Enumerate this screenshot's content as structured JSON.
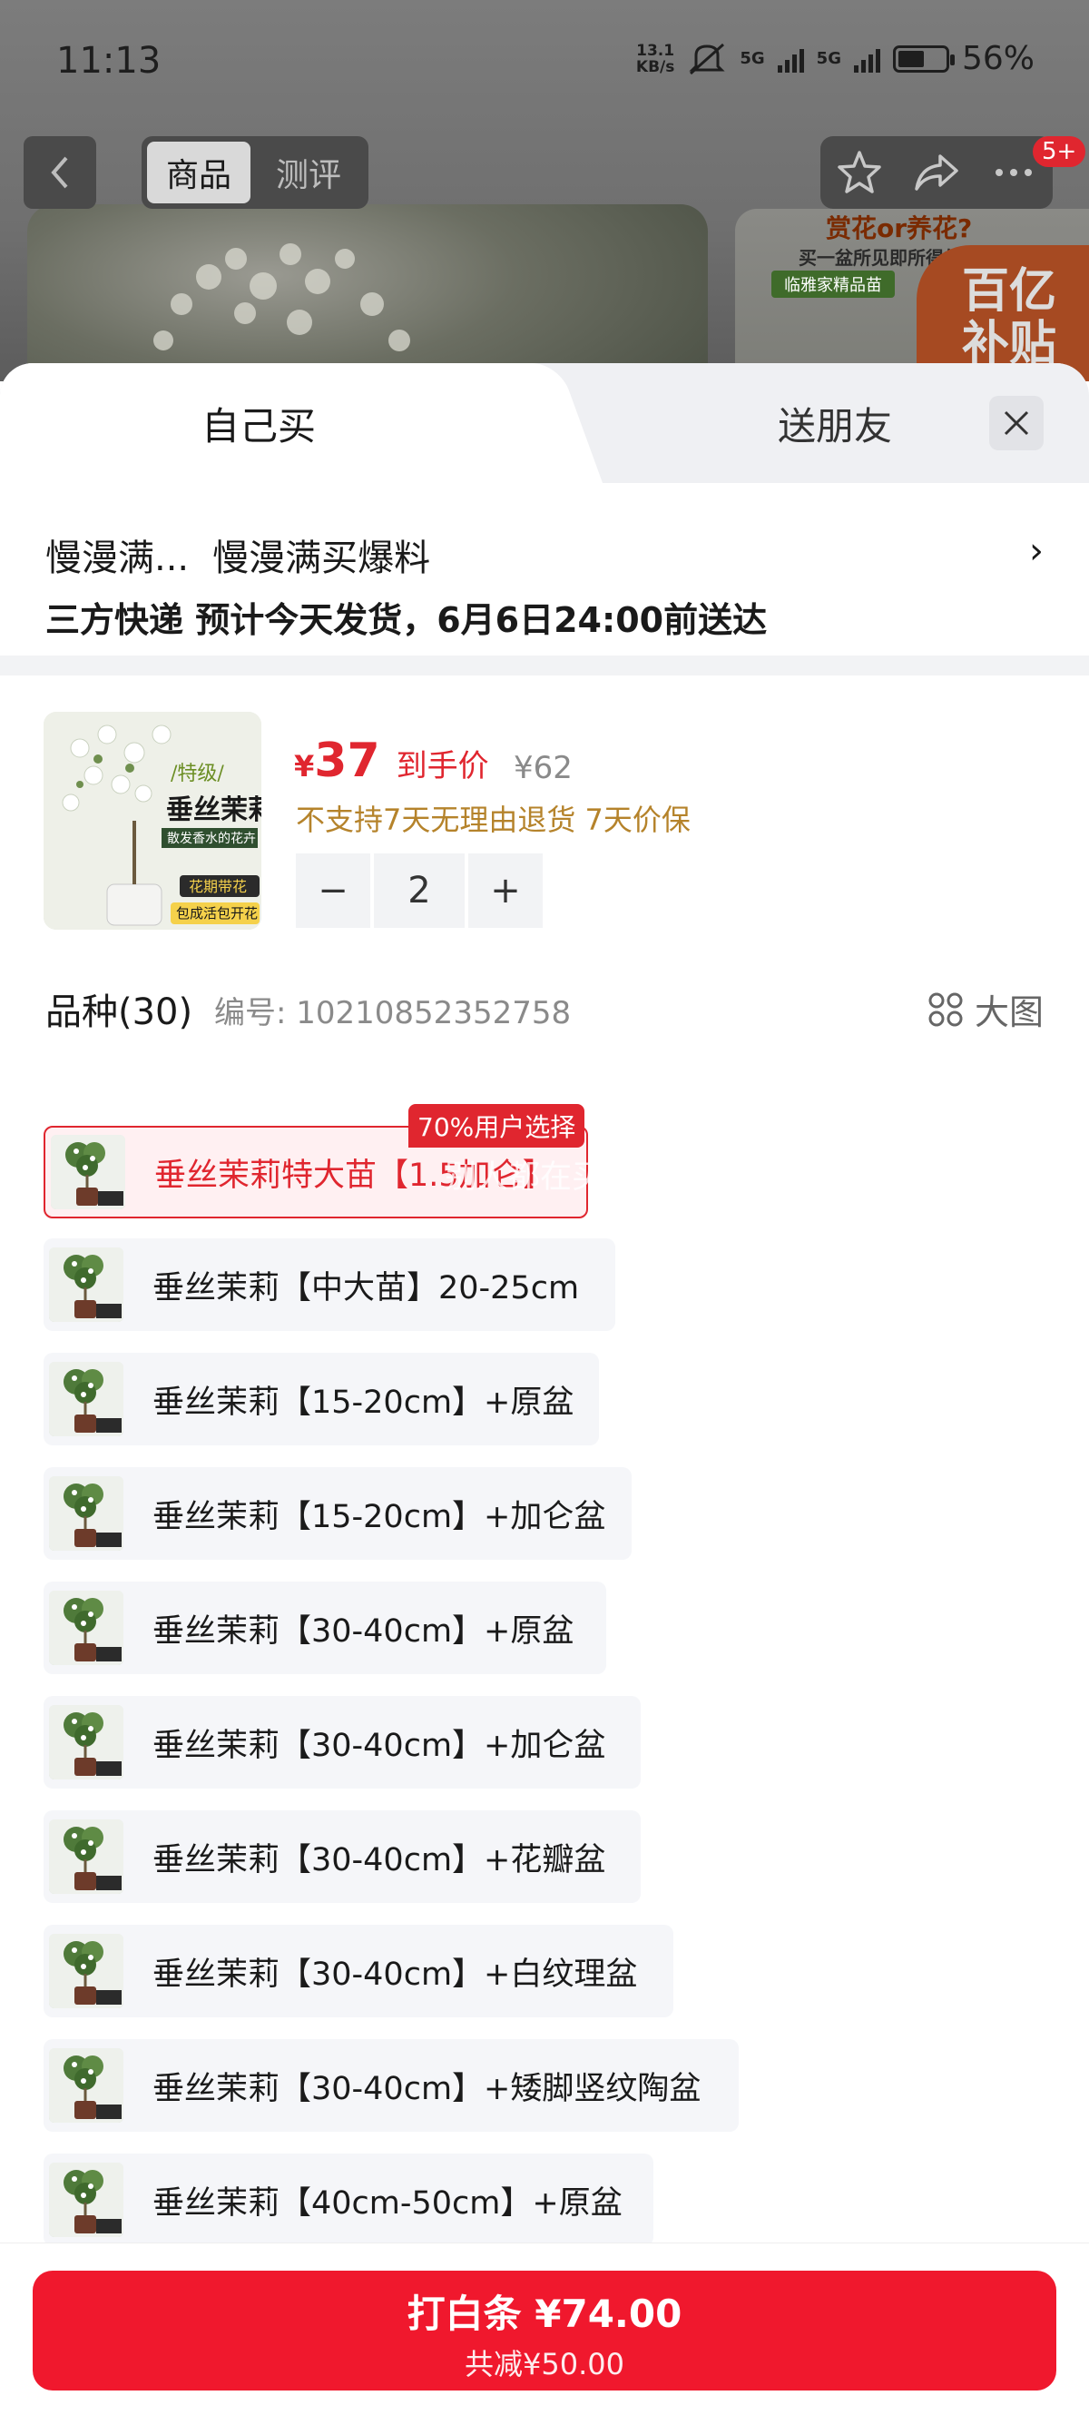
{
  "status_bar": {
    "time": "11:13",
    "net_speed_value": "13.1",
    "net_speed_unit": "KB/s",
    "signal_1": "5G",
    "signal_2": "5G",
    "battery": "56%",
    "battery_level": 0.56
  },
  "nav": {
    "tab_goods": "商品",
    "tab_review": "测评",
    "badge": "5+"
  },
  "background_promo": {
    "title": "赏花or养花?",
    "subtitle": "买一盆所见即所得的",
    "tag": "临雅家精品苗",
    "subsidy_1": "百亿",
    "subsidy_2": "补贴"
  },
  "sheet": {
    "tab_own": "自己买",
    "tab_gift": "送朋友",
    "address_short": "慢漫满...",
    "address_label": "慢漫满买爆料",
    "shipping": "三方快递 预计今天发货，6月6日24:00前送达"
  },
  "product": {
    "thumb_title": "垂丝茉莉",
    "thumb_sub_1": "/特级/",
    "thumb_sub_2": "散发香水的花卉",
    "thumb_tag_1": "花期带花",
    "thumb_tag_2": "包成活包开花",
    "price_currency": "¥",
    "price_value": "37",
    "price_tag": "到手价",
    "price_original": "¥62",
    "policy": "不支持7天无理由退货 7天价保",
    "quantity": "2",
    "minus": "−",
    "plus": "+"
  },
  "variants": {
    "title": "品种(30)",
    "code": "编号: 10210852352758",
    "big_view": "大图",
    "popular_tag": "70%用户选择",
    "selected_overlay": "别人都在买",
    "items": [
      {
        "label": "垂丝茉莉特大苗【1.5加仑】"
      },
      {
        "label": "垂丝茉莉【中大苗】20-25cm"
      },
      {
        "label": "垂丝茉莉【15-20cm】+原盆"
      },
      {
        "label": "垂丝茉莉【15-20cm】+加仑盆"
      },
      {
        "label": "垂丝茉莉【30-40cm】+原盆"
      },
      {
        "label": "垂丝茉莉【30-40cm】+加仑盆"
      },
      {
        "label": "垂丝茉莉【30-40cm】+花瓣盆"
      },
      {
        "label": "垂丝茉莉【30-40cm】+白纹理盆"
      },
      {
        "label": "垂丝茉莉【30-40cm】+矮脚竖纹陶盆"
      },
      {
        "label": "垂丝茉莉【40cm-50cm】+原盆"
      }
    ]
  },
  "footer": {
    "buy_label": "打白条 ¥74.00",
    "discount": "共减¥50.00"
  },
  "colors": {
    "accent": "#e0262f",
    "button": "#f0182d",
    "policy": "#b5832b"
  }
}
